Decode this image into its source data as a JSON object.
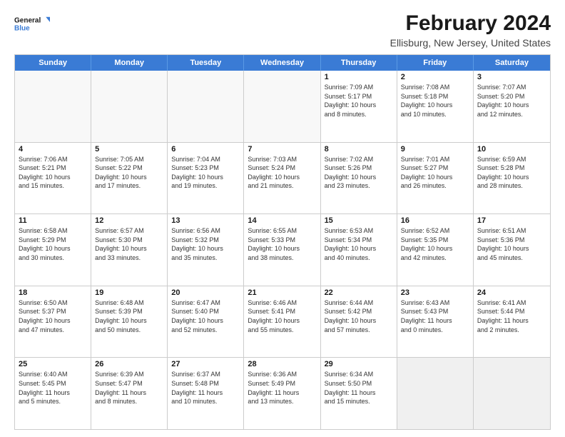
{
  "logo": {
    "line1": "General",
    "line2": "Blue"
  },
  "title": "February 2024",
  "subtitle": "Ellisburg, New Jersey, United States",
  "header": {
    "days": [
      "Sunday",
      "Monday",
      "Tuesday",
      "Wednesday",
      "Thursday",
      "Friday",
      "Saturday"
    ]
  },
  "rows": [
    [
      {
        "day": "",
        "lines": []
      },
      {
        "day": "",
        "lines": []
      },
      {
        "day": "",
        "lines": []
      },
      {
        "day": "",
        "lines": []
      },
      {
        "day": "1",
        "lines": [
          "Sunrise: 7:09 AM",
          "Sunset: 5:17 PM",
          "Daylight: 10 hours",
          "and 8 minutes."
        ]
      },
      {
        "day": "2",
        "lines": [
          "Sunrise: 7:08 AM",
          "Sunset: 5:18 PM",
          "Daylight: 10 hours",
          "and 10 minutes."
        ]
      },
      {
        "day": "3",
        "lines": [
          "Sunrise: 7:07 AM",
          "Sunset: 5:20 PM",
          "Daylight: 10 hours",
          "and 12 minutes."
        ]
      }
    ],
    [
      {
        "day": "4",
        "lines": [
          "Sunrise: 7:06 AM",
          "Sunset: 5:21 PM",
          "Daylight: 10 hours",
          "and 15 minutes."
        ]
      },
      {
        "day": "5",
        "lines": [
          "Sunrise: 7:05 AM",
          "Sunset: 5:22 PM",
          "Daylight: 10 hours",
          "and 17 minutes."
        ]
      },
      {
        "day": "6",
        "lines": [
          "Sunrise: 7:04 AM",
          "Sunset: 5:23 PM",
          "Daylight: 10 hours",
          "and 19 minutes."
        ]
      },
      {
        "day": "7",
        "lines": [
          "Sunrise: 7:03 AM",
          "Sunset: 5:24 PM",
          "Daylight: 10 hours",
          "and 21 minutes."
        ]
      },
      {
        "day": "8",
        "lines": [
          "Sunrise: 7:02 AM",
          "Sunset: 5:26 PM",
          "Daylight: 10 hours",
          "and 23 minutes."
        ]
      },
      {
        "day": "9",
        "lines": [
          "Sunrise: 7:01 AM",
          "Sunset: 5:27 PM",
          "Daylight: 10 hours",
          "and 26 minutes."
        ]
      },
      {
        "day": "10",
        "lines": [
          "Sunrise: 6:59 AM",
          "Sunset: 5:28 PM",
          "Daylight: 10 hours",
          "and 28 minutes."
        ]
      }
    ],
    [
      {
        "day": "11",
        "lines": [
          "Sunrise: 6:58 AM",
          "Sunset: 5:29 PM",
          "Daylight: 10 hours",
          "and 30 minutes."
        ]
      },
      {
        "day": "12",
        "lines": [
          "Sunrise: 6:57 AM",
          "Sunset: 5:30 PM",
          "Daylight: 10 hours",
          "and 33 minutes."
        ]
      },
      {
        "day": "13",
        "lines": [
          "Sunrise: 6:56 AM",
          "Sunset: 5:32 PM",
          "Daylight: 10 hours",
          "and 35 minutes."
        ]
      },
      {
        "day": "14",
        "lines": [
          "Sunrise: 6:55 AM",
          "Sunset: 5:33 PM",
          "Daylight: 10 hours",
          "and 38 minutes."
        ]
      },
      {
        "day": "15",
        "lines": [
          "Sunrise: 6:53 AM",
          "Sunset: 5:34 PM",
          "Daylight: 10 hours",
          "and 40 minutes."
        ]
      },
      {
        "day": "16",
        "lines": [
          "Sunrise: 6:52 AM",
          "Sunset: 5:35 PM",
          "Daylight: 10 hours",
          "and 42 minutes."
        ]
      },
      {
        "day": "17",
        "lines": [
          "Sunrise: 6:51 AM",
          "Sunset: 5:36 PM",
          "Daylight: 10 hours",
          "and 45 minutes."
        ]
      }
    ],
    [
      {
        "day": "18",
        "lines": [
          "Sunrise: 6:50 AM",
          "Sunset: 5:37 PM",
          "Daylight: 10 hours",
          "and 47 minutes."
        ]
      },
      {
        "day": "19",
        "lines": [
          "Sunrise: 6:48 AM",
          "Sunset: 5:39 PM",
          "Daylight: 10 hours",
          "and 50 minutes."
        ]
      },
      {
        "day": "20",
        "lines": [
          "Sunrise: 6:47 AM",
          "Sunset: 5:40 PM",
          "Daylight: 10 hours",
          "and 52 minutes."
        ]
      },
      {
        "day": "21",
        "lines": [
          "Sunrise: 6:46 AM",
          "Sunset: 5:41 PM",
          "Daylight: 10 hours",
          "and 55 minutes."
        ]
      },
      {
        "day": "22",
        "lines": [
          "Sunrise: 6:44 AM",
          "Sunset: 5:42 PM",
          "Daylight: 10 hours",
          "and 57 minutes."
        ]
      },
      {
        "day": "23",
        "lines": [
          "Sunrise: 6:43 AM",
          "Sunset: 5:43 PM",
          "Daylight: 11 hours",
          "and 0 minutes."
        ]
      },
      {
        "day": "24",
        "lines": [
          "Sunrise: 6:41 AM",
          "Sunset: 5:44 PM",
          "Daylight: 11 hours",
          "and 2 minutes."
        ]
      }
    ],
    [
      {
        "day": "25",
        "lines": [
          "Sunrise: 6:40 AM",
          "Sunset: 5:45 PM",
          "Daylight: 11 hours",
          "and 5 minutes."
        ]
      },
      {
        "day": "26",
        "lines": [
          "Sunrise: 6:39 AM",
          "Sunset: 5:47 PM",
          "Daylight: 11 hours",
          "and 8 minutes."
        ]
      },
      {
        "day": "27",
        "lines": [
          "Sunrise: 6:37 AM",
          "Sunset: 5:48 PM",
          "Daylight: 11 hours",
          "and 10 minutes."
        ]
      },
      {
        "day": "28",
        "lines": [
          "Sunrise: 6:36 AM",
          "Sunset: 5:49 PM",
          "Daylight: 11 hours",
          "and 13 minutes."
        ]
      },
      {
        "day": "29",
        "lines": [
          "Sunrise: 6:34 AM",
          "Sunset: 5:50 PM",
          "Daylight: 11 hours",
          "and 15 minutes."
        ]
      },
      {
        "day": "",
        "lines": []
      },
      {
        "day": "",
        "lines": []
      }
    ]
  ]
}
